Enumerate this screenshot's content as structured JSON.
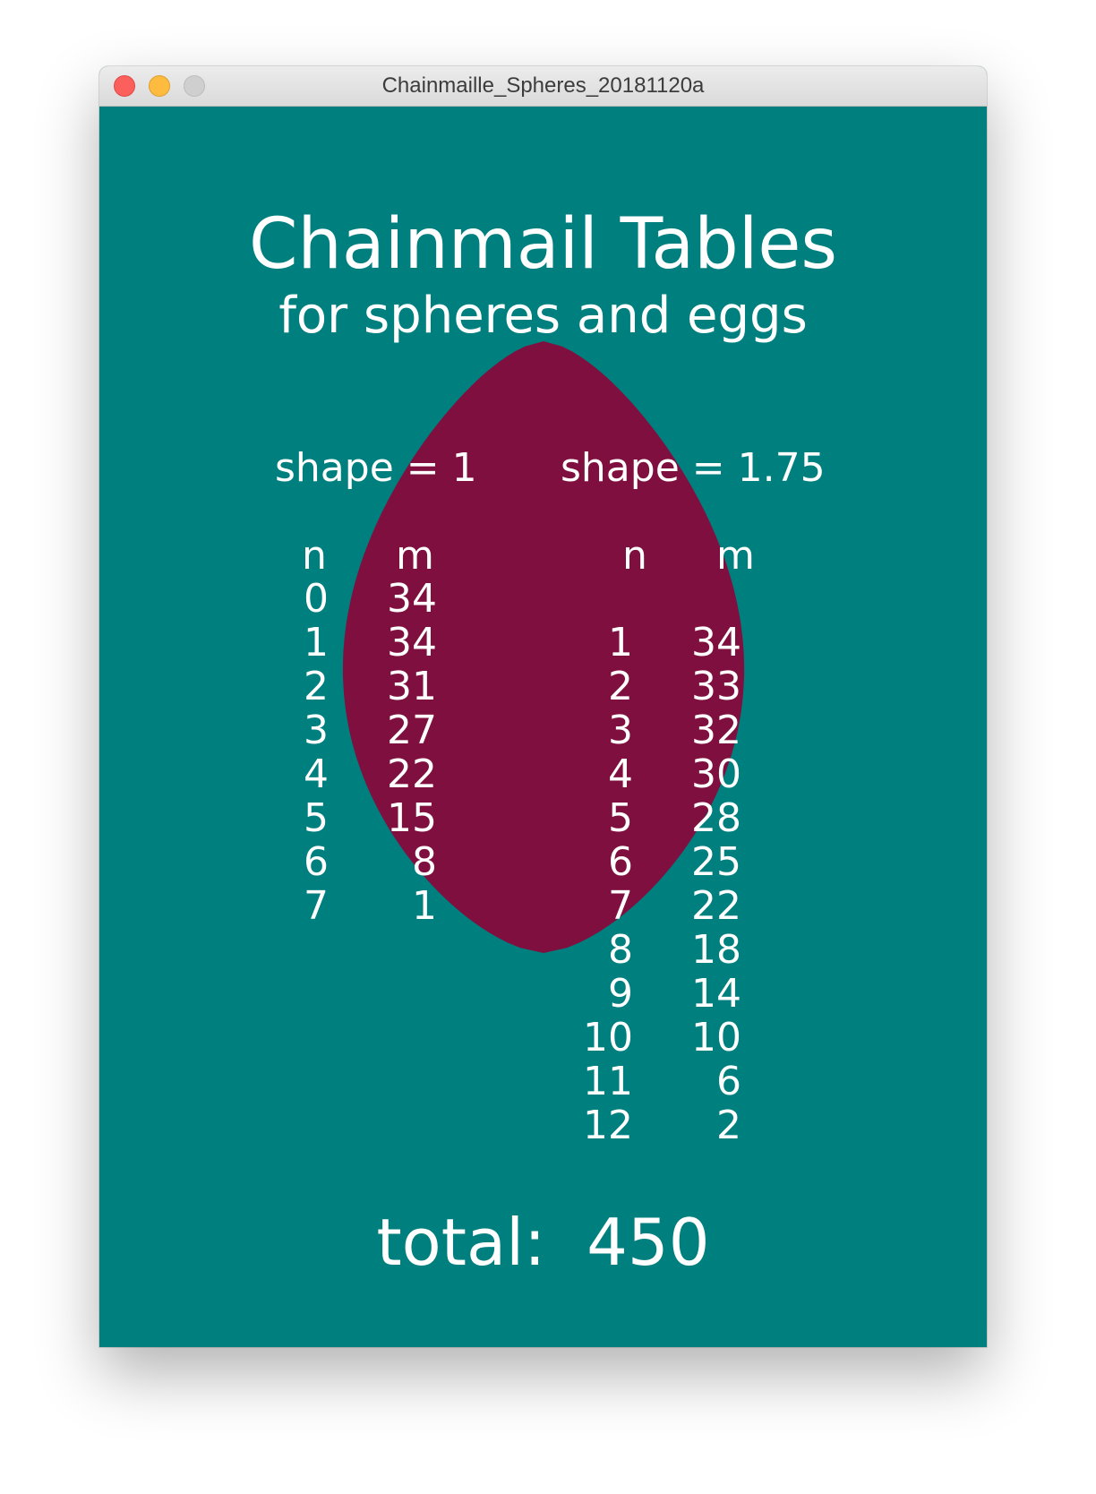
{
  "window": {
    "title": "Chainmaille_Spheres_20181120a"
  },
  "colors": {
    "background": "#007f7f",
    "egg": "#7f0f3e",
    "text": "#ffffff"
  },
  "heading": {
    "title": "Chainmail Tables",
    "subtitle": "for spheres and eggs"
  },
  "tables": [
    {
      "shape_label": "shape = 1",
      "col_n": "n",
      "col_m": "m",
      "rows": [
        {
          "n": "0",
          "m": "34"
        },
        {
          "n": "1",
          "m": "34"
        },
        {
          "n": "2",
          "m": "31"
        },
        {
          "n": "3",
          "m": "27"
        },
        {
          "n": "4",
          "m": "22"
        },
        {
          "n": "5",
          "m": "15"
        },
        {
          "n": "6",
          "m": "8"
        },
        {
          "n": "7",
          "m": "1"
        }
      ]
    },
    {
      "shape_label": "shape = 1.75",
      "col_n": "n",
      "col_m": "m",
      "rows": [
        {
          "n": "1",
          "m": "34"
        },
        {
          "n": "2",
          "m": "33"
        },
        {
          "n": "3",
          "m": "32"
        },
        {
          "n": "4",
          "m": "30"
        },
        {
          "n": "5",
          "m": "28"
        },
        {
          "n": "6",
          "m": "25"
        },
        {
          "n": "7",
          "m": "22"
        },
        {
          "n": "8",
          "m": "18"
        },
        {
          "n": "9",
          "m": "14"
        },
        {
          "n": "10",
          "m": "10"
        },
        {
          "n": "11",
          "m": "6"
        },
        {
          "n": "12",
          "m": "2"
        }
      ]
    }
  ],
  "total": {
    "text": "total:  450"
  }
}
